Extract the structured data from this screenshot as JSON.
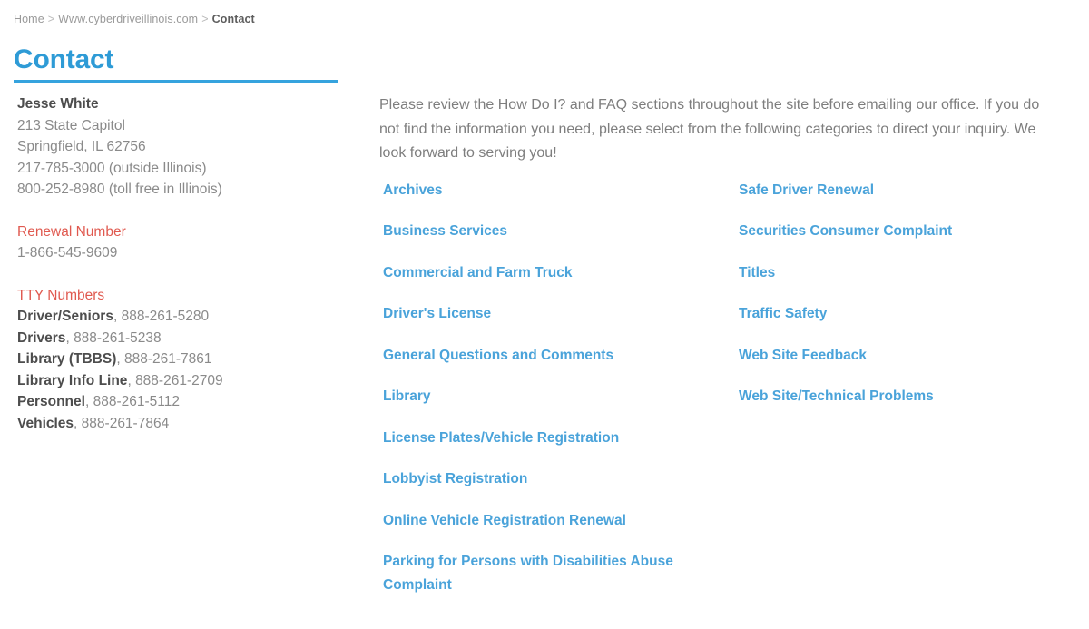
{
  "breadcrumb": {
    "items": [
      "Home",
      "Www.cyberdriveillinois.com",
      "Contact"
    ],
    "separator": ">"
  },
  "page": {
    "title": "Contact"
  },
  "colors": {
    "heading_blue": "#2e9bd6",
    "rule_blue": "#35a3de",
    "link_blue": "#4aa3da",
    "accent_red": "#e0594f",
    "body_gray": "#8a8a8a",
    "strong_gray": "#4d4d4d",
    "breadcrumb_gray": "#9a9a9a"
  },
  "contact_card": {
    "name": "Jesse White",
    "address_lines": [
      "213 State Capitol",
      "Springfield, IL 62756",
      "217-785-3000 (outside Illinois)",
      "800-252-8980 (toll free in Illinois)"
    ],
    "renewal": {
      "heading": "Renewal Number",
      "number": "1-866-545-9609"
    },
    "tty": {
      "heading": "TTY Numbers",
      "entries": [
        {
          "label": "Driver/Seniors",
          "number": "888-261-5280"
        },
        {
          "label": "Drivers",
          "number": "888-261-5238"
        },
        {
          "label": "Library (TBBS)",
          "number": "888-261-7861"
        },
        {
          "label": "Library Info Line",
          "number": "888-261-2709"
        },
        {
          "label": "Personnel",
          "number": "888-261-5112"
        },
        {
          "label": "Vehicles",
          "number": "888-261-7864"
        }
      ]
    }
  },
  "main": {
    "intro": "Please review the How Do I? and FAQ sections throughout the site before emailing our office. If you do not find the information you need, please select from the following categories to direct your inquiry. We look forward to serving you!",
    "categories_column_1": [
      "Archives",
      "Business Services",
      "Commercial and Farm Truck",
      "Driver's License",
      "General Questions and Comments",
      "Library",
      "License Plates/Vehicle Registration",
      "Lobbyist Registration",
      "Online Vehicle Registration Renewal",
      "Parking for Persons with Disabilities Abuse Complaint"
    ],
    "categories_column_2": [
      "Safe Driver Renewal",
      "Securities Consumer Complaint",
      "Titles",
      "Traffic Safety",
      "Web Site Feedback",
      "Web Site/Technical Problems"
    ]
  }
}
